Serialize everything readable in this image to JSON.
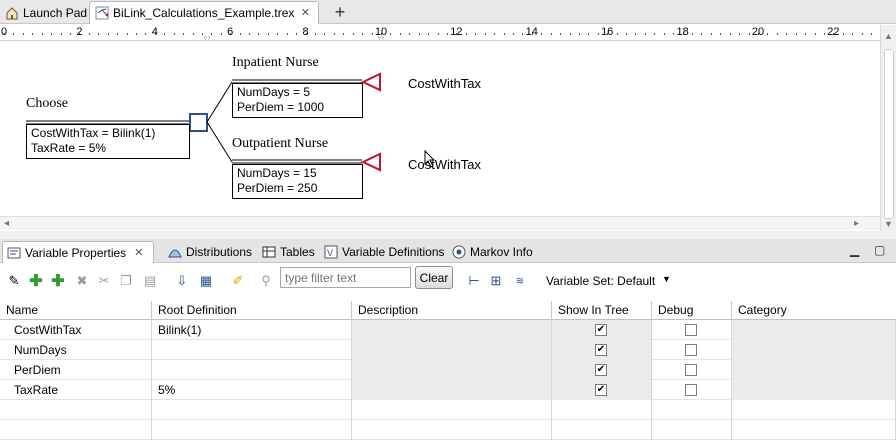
{
  "editor_tabs": [
    {
      "label": "Launch Pad",
      "icon": "home-icon"
    },
    {
      "label": "BiLink_Calculations_Example.trex",
      "icon": "tree-file-icon"
    }
  ],
  "ruler": {
    "numbers": [
      "0",
      "2",
      "4",
      "6",
      "8",
      "10",
      "12",
      "14",
      "16",
      "18",
      "20",
      "22"
    ]
  },
  "tree": {
    "choice_node": {
      "title": "Choose",
      "vars": [
        "CostWithTax = Bilink(1)",
        "TaxRate = 5%"
      ]
    },
    "branches": [
      {
        "title": "Inpatient Nurse",
        "vars": [
          "NumDays = 5",
          "PerDiem = 1000"
        ],
        "terminal_label": "CostWithTax"
      },
      {
        "title": "Outpatient Nurse",
        "vars": [
          "NumDays = 15",
          "PerDiem = 250"
        ],
        "terminal_label": "CostWithTax"
      }
    ],
    "colors": {
      "decision": "#2b4f8c",
      "terminal": "#c8102e"
    }
  },
  "view_tabs": [
    {
      "label": "Variable Properties",
      "icon": "variable-properties-icon",
      "closable": true
    },
    {
      "label": "Distributions",
      "icon": "distributions-icon"
    },
    {
      "label": "Tables",
      "icon": "tables-icon"
    },
    {
      "label": "Variable Definitions",
      "icon": "variable-definitions-icon"
    },
    {
      "label": "Markov Info",
      "icon": "markov-info-icon"
    }
  ],
  "toolbar": {
    "filter_placeholder": "type filter text",
    "clear_label": "Clear",
    "variable_set_label": "Variable Set: Default"
  },
  "table": {
    "columns": [
      "Name",
      "Root Definition",
      "Description",
      "Show In Tree",
      "Debug",
      "Category"
    ],
    "rows": [
      {
        "name": "CostWithTax",
        "root_definition": "Bilink(1)",
        "description": "",
        "show_in_tree": true,
        "debug": false,
        "category": ""
      },
      {
        "name": "NumDays",
        "root_definition": "",
        "description": "",
        "show_in_tree": true,
        "debug": false,
        "category": ""
      },
      {
        "name": "PerDiem",
        "root_definition": "",
        "description": "",
        "show_in_tree": true,
        "debug": false,
        "category": ""
      },
      {
        "name": "TaxRate",
        "root_definition": "5%",
        "description": "",
        "show_in_tree": true,
        "debug": false,
        "category": ""
      }
    ]
  }
}
